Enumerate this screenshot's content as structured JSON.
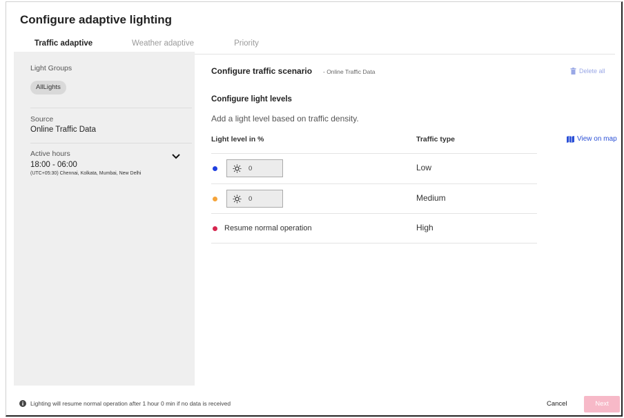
{
  "header": {
    "title": "Configure adaptive lighting"
  },
  "tabs": [
    {
      "label": "Traffic adaptive",
      "active": true
    },
    {
      "label": "Weather adaptive",
      "active": false
    },
    {
      "label": "Priority",
      "active": false
    }
  ],
  "sidebar": {
    "light_groups_label": "Light Groups",
    "light_group_chip": "AllLights",
    "source_label": "Source",
    "source_value": "Online Traffic Data",
    "active_hours_label": "Active hours",
    "active_hours_value": "18:00 - 06:00",
    "timezone": "(UTC+05:30) Chennai, Kolkata, Mumbai, New Delhi"
  },
  "scenario": {
    "heading": "Configure traffic scenario",
    "subheading": "- Online Traffic Data",
    "delete_all": "Delete all",
    "levels_heading": "Configure light levels",
    "levels_description": "Add a light level based on traffic density.",
    "col_light_level": "Light level in %",
    "col_traffic_type": "Traffic type",
    "view_on_map": "View on map",
    "rows": [
      {
        "color": "#1f3fe0",
        "value": "0",
        "traffic": "Low"
      },
      {
        "color": "#f5a43a",
        "value": "0",
        "traffic": "Medium"
      },
      {
        "color": "#d6264f",
        "label": "Resume normal operation",
        "traffic": "High"
      }
    ]
  },
  "footer": {
    "info": "Lighting will resume normal operation after 1 hour 0 min if no data is received",
    "cancel": "Cancel",
    "next": "Next"
  },
  "colors": {
    "accent": "#d6264f",
    "link": "#2a4fd6",
    "next_disabled": "#f7b9c8"
  }
}
